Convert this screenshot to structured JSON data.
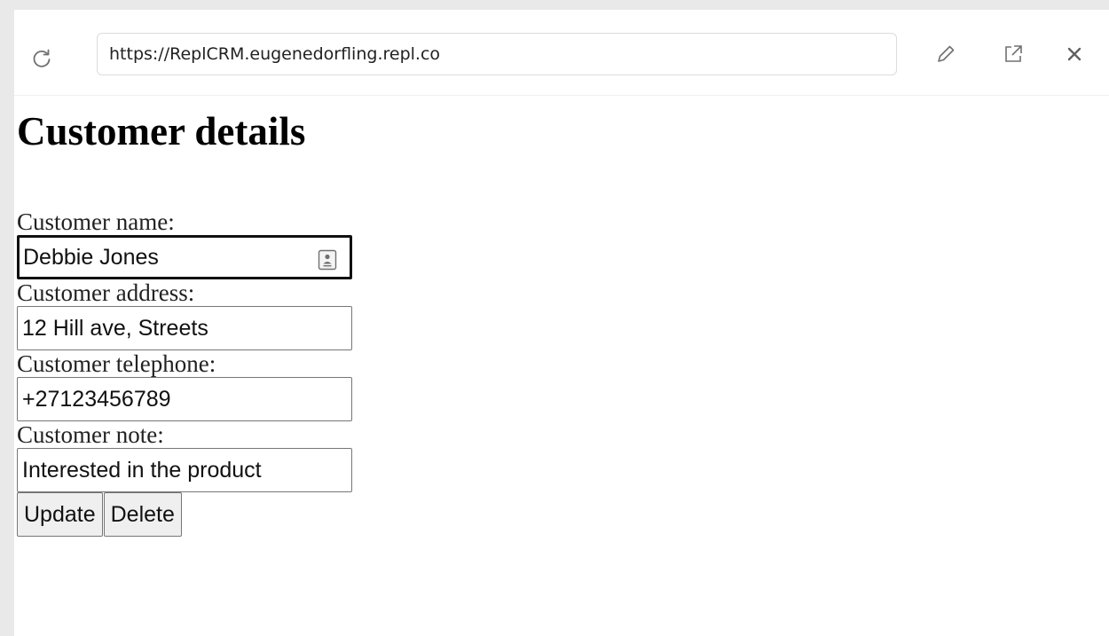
{
  "browser": {
    "url": "https://ReplCRM.eugenedorfling.repl.co",
    "icons": [
      "reload-icon",
      "edit-icon",
      "open-external-icon",
      "close-icon"
    ]
  },
  "page": {
    "title": "Customer details"
  },
  "form": {
    "name_label": "Customer name:",
    "name_value": "Debbie Jones",
    "address_label": "Customer address:",
    "address_value": "12 Hill ave, Streets",
    "telephone_label": "Customer telephone:",
    "telephone_value": "+27123456789",
    "note_label": "Customer note:",
    "note_value": "Interested in the product"
  },
  "actions": {
    "update_label": "Update",
    "delete_label": "Delete"
  }
}
